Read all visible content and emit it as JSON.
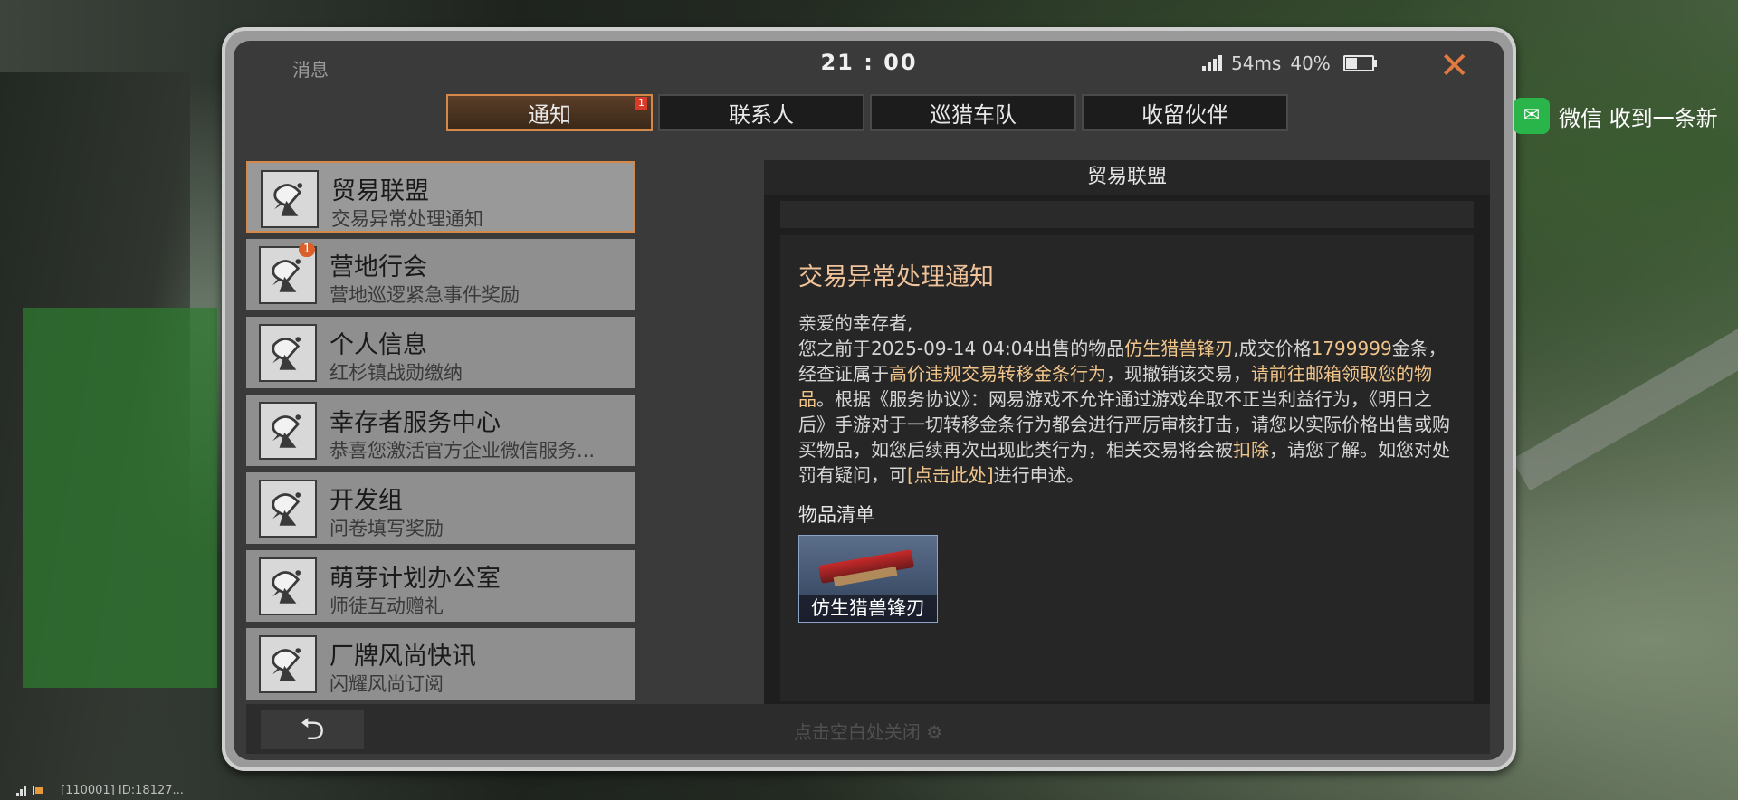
{
  "status": {
    "left_label": "消息",
    "time": "21 : 00",
    "ping": "54ms",
    "battery": "40%",
    "battery_level": 0.4
  },
  "tabs": [
    {
      "label": "通知",
      "badge": "1",
      "active": true
    },
    {
      "label": "联系人"
    },
    {
      "label": "巡猎车队"
    },
    {
      "label": "收留伙伴"
    }
  ],
  "list": [
    {
      "title": "贸易联盟",
      "subtitle": "交易异常处理通知",
      "selected": true,
      "badge": ""
    },
    {
      "title": "营地行会",
      "subtitle": "营地巡逻紧急事件奖励",
      "badge": "1"
    },
    {
      "title": "个人信息",
      "subtitle": "红杉镇战勋缴纳",
      "badge": ""
    },
    {
      "title": "幸存者服务中心",
      "subtitle": "恭喜您激活官方企业微信服务...",
      "badge": ""
    },
    {
      "title": "开发组",
      "subtitle": "问卷填写奖励",
      "badge": ""
    },
    {
      "title": "萌芽计划办公室",
      "subtitle": "师徒互动赠礼",
      "badge": ""
    },
    {
      "title": "厂牌风尚快讯",
      "subtitle": "闪耀风尚订阅",
      "badge": ""
    }
  ],
  "detail": {
    "header": "贸易联盟",
    "title": "交易异常处理通知",
    "greeting": "亲爱的幸存者,",
    "p_a": "您之前于2025-09-14 04:04出售的物品",
    "p_b": "仿生猎兽锋刃",
    "p_c": ",成交价格",
    "p_d": "1799999",
    "p_e": "金条，经查证属于",
    "p_f": "高价违规交易转移金条行为",
    "p_g": "，现撤销该交易，",
    "p_h": "请前往邮箱领取您的物品",
    "p_i": "。根据《服务协议》：网易游戏不允许通过游戏牟取不正当利益行为，《明日之后》手游对于一切转移金条行为都会进行严厉审核打击，请您以实际价格出售或购买物品，如您后续再次出现此类行为，相关交易将会被",
    "p_j": "扣除",
    "p_k": "，请您了解。如您对处罚有疑问，可",
    "p_l": "[点击此处]",
    "p_m": "进行申述。",
    "items_label": "物品清单",
    "item_name": "仿生猎兽锋刃"
  },
  "bottom": {
    "back": "⮌",
    "close_hint": "点击空白处关闭 ⚙"
  },
  "wechat": {
    "label": "微信 收到一条新"
  },
  "footer": {
    "text": "[110001] ID:18127..."
  },
  "colors": {
    "accent": "#d4884a",
    "highlight": "#f2c58a",
    "badge": "#d93a2a"
  }
}
